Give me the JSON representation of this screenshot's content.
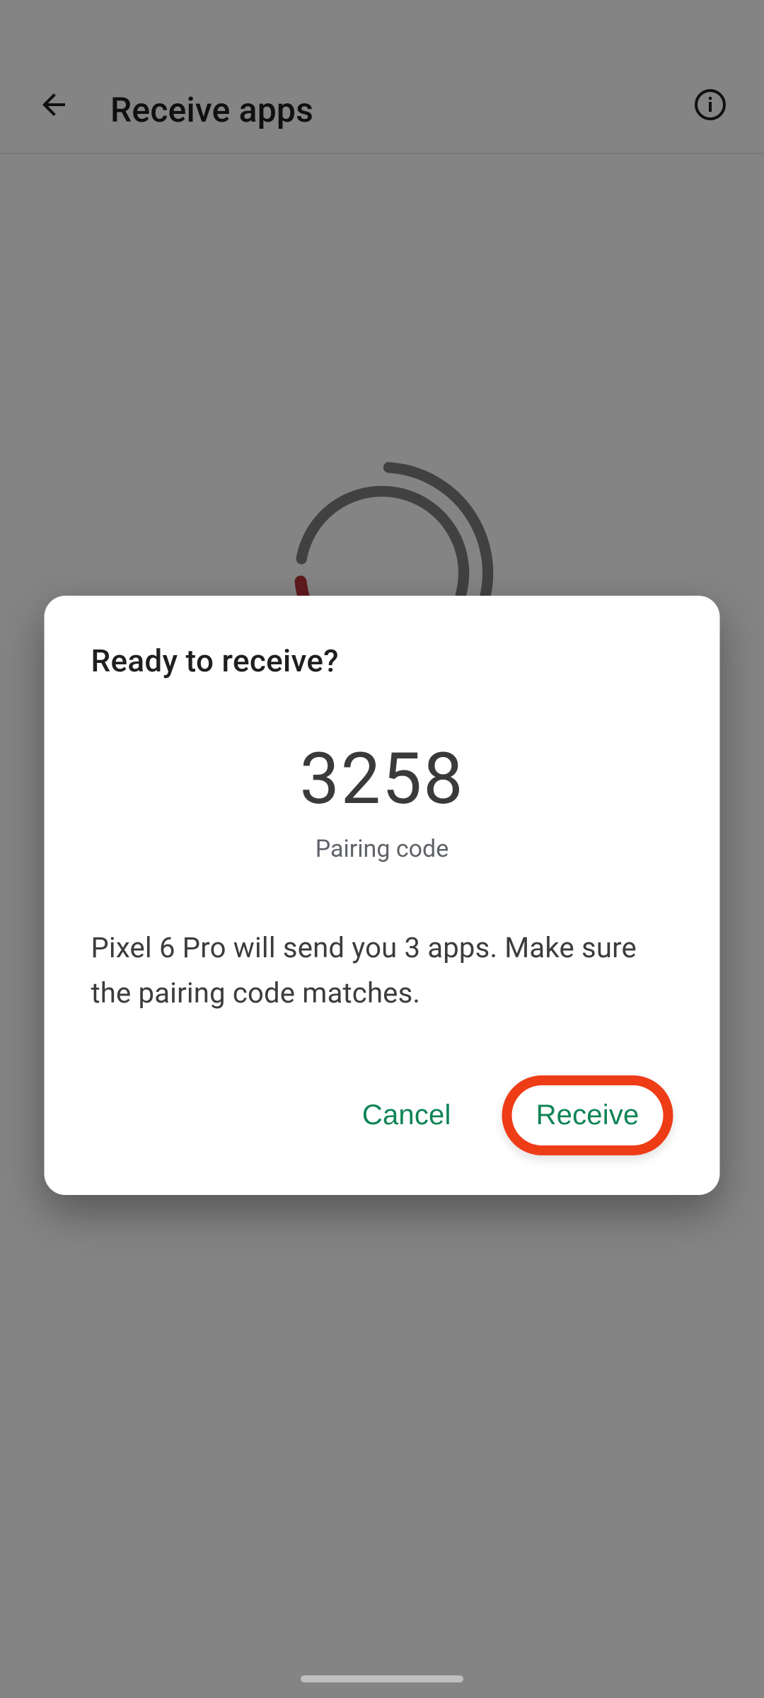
{
  "header": {
    "title": "Receive apps"
  },
  "dialog": {
    "title": "Ready to receive?",
    "pairing_code": "3258",
    "pairing_label": "Pairing code",
    "body": "Pixel 6 Pro will send you 3 apps. Make sure the pairing code matches.",
    "cancel_label": "Cancel",
    "receive_label": "Receive"
  },
  "colors": {
    "accent_green": "#0f8456",
    "highlight_red": "#ee3c17",
    "spinner_gray": "#7d7d7d",
    "spinner_accent": "#b53338"
  }
}
